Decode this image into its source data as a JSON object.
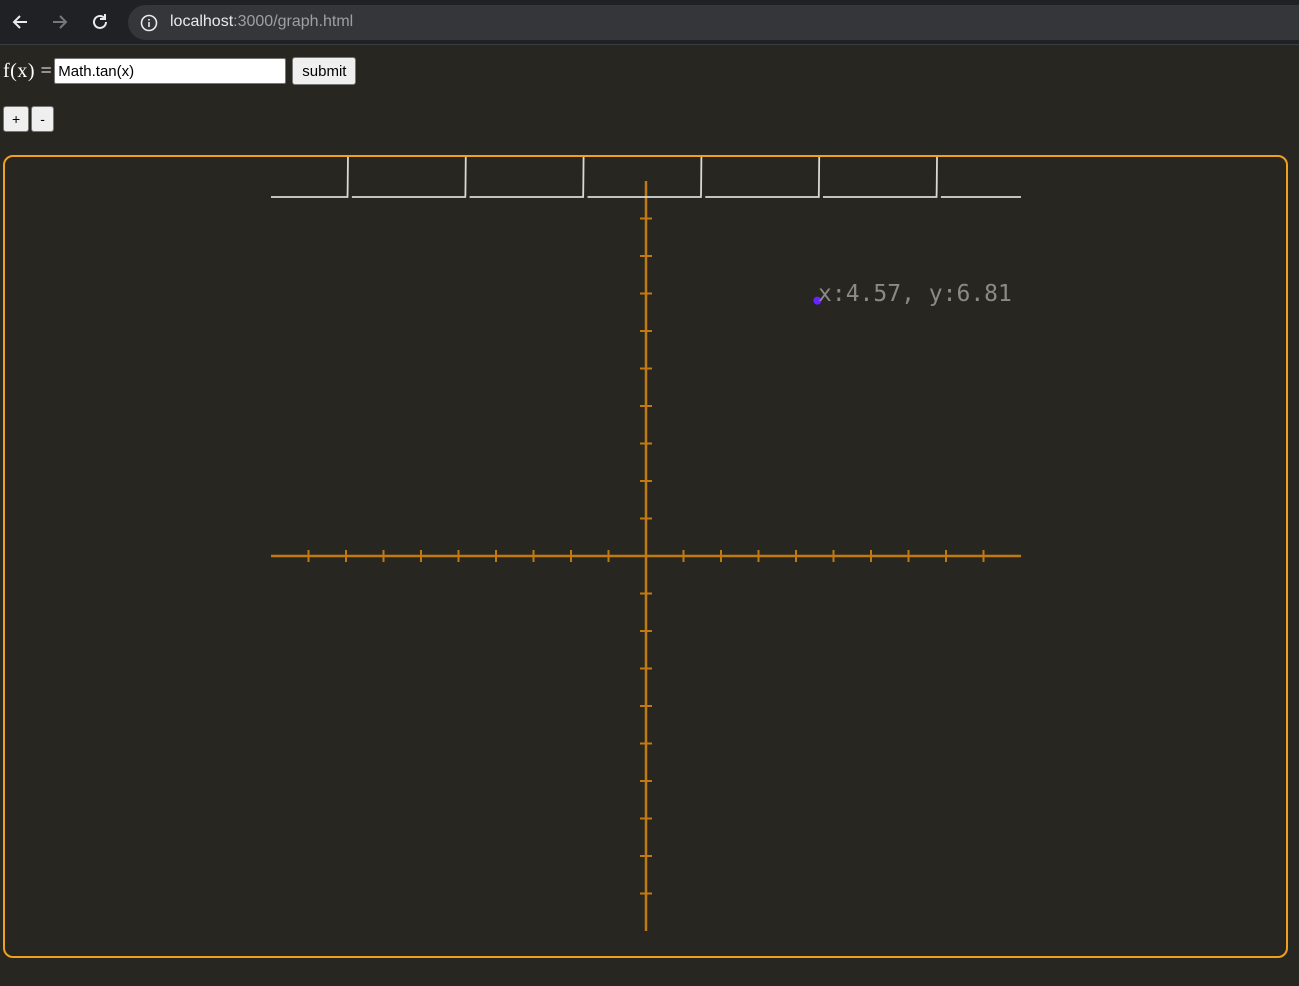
{
  "browser": {
    "url_host": "localhost",
    "url_path": ":3000/graph.html"
  },
  "form": {
    "label": "f(x) =",
    "input_value": "Math.tan(x)",
    "submit_label": "submit"
  },
  "zoom": {
    "in_label": "+",
    "out_label": "-"
  },
  "graph": {
    "function": "tan",
    "x_range": [
      -10,
      10
    ],
    "y_range": [
      -10,
      10
    ],
    "tick_step": 1,
    "axis_color": "#c07a10",
    "curve_color": "#d8d8d4",
    "border_color": "#f0a020",
    "hover_point": {
      "x": 4.57,
      "y": 6.81
    },
    "hover_point_color": "#6a22ff",
    "hover_label": "x:4.57, y:6.81"
  }
}
